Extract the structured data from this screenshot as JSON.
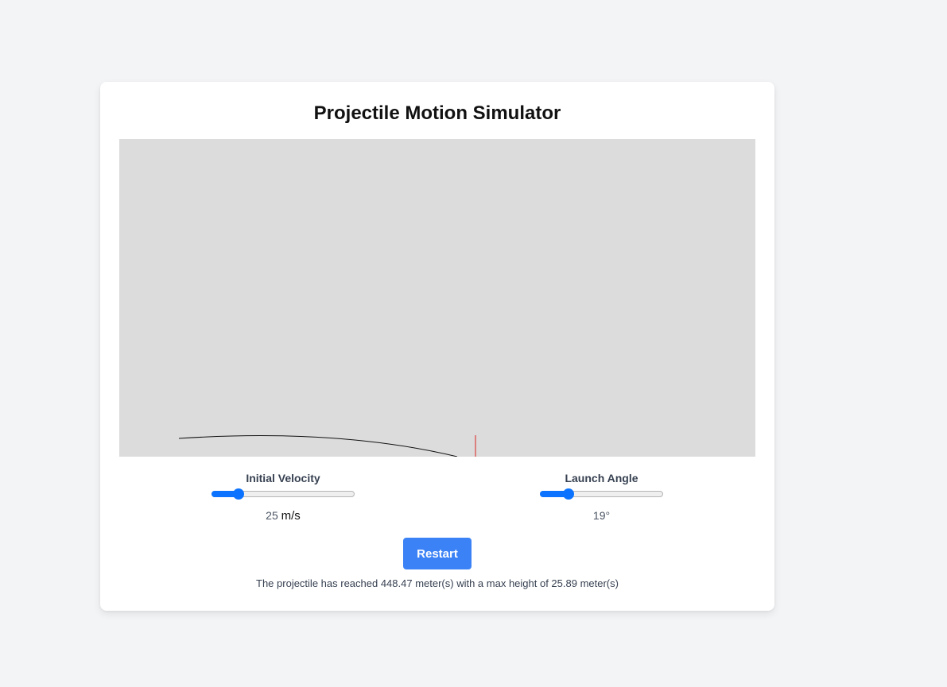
{
  "title": "Projectile Motion Simulator",
  "velocity": {
    "label": "Initial Velocity",
    "value": "25",
    "unit": "m/s",
    "fraction": 0.19
  },
  "angle": {
    "label": "Launch Angle",
    "value": "19°",
    "fraction": 0.23
  },
  "restart_label": "Restart",
  "status": "The projectile has reached 448.47 meter(s) with a max height of 25.89 meter(s)",
  "colors": {
    "accent": "#3b82f6",
    "slider": "#0b73ff",
    "canvas_bg": "#dcdcdc",
    "trajectory": "#111111",
    "marker": "#dd2222"
  }
}
